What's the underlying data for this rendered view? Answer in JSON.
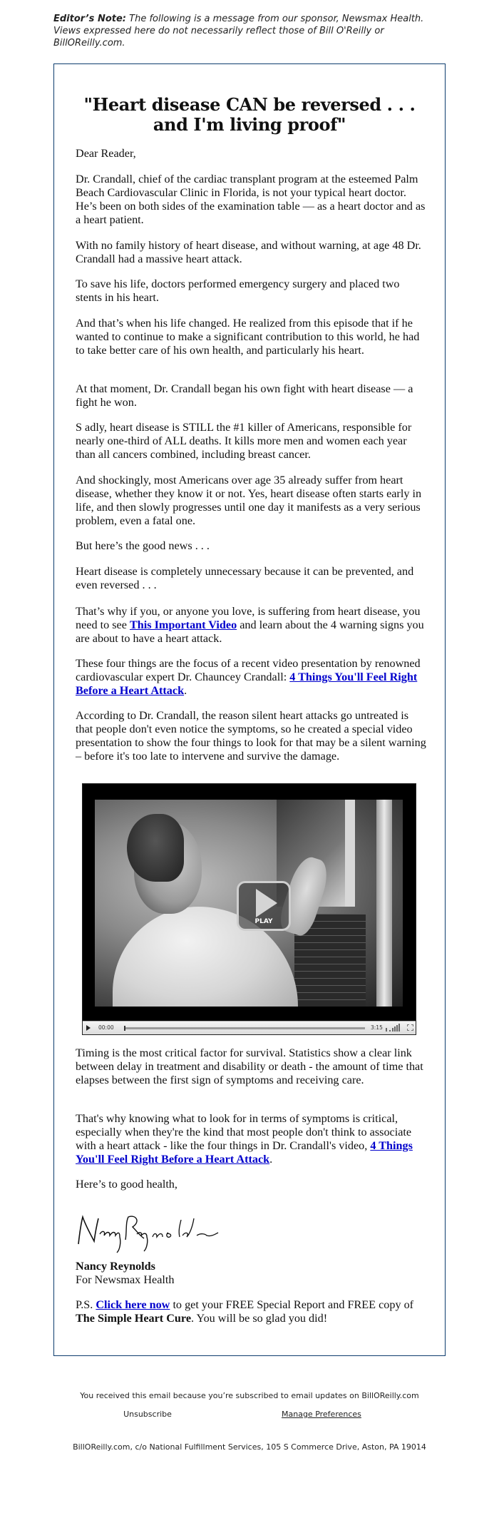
{
  "editor_note": {
    "label": "Editor’s Note:",
    "text": " The following is a message from our sponsor, Newsmax Health. Views expressed here do not necessarily reflect those of Bill O'Reilly or BillOReilly.com."
  },
  "headline": {
    "line1": "\"Heart disease CAN be reversed . . .",
    "line2": "and I'm living proof\""
  },
  "body": {
    "salutation": "Dear Reader,",
    "p1": "Dr. Crandall, chief of the cardiac transplant program at the esteemed Palm Beach Cardiovascular Clinic in Florida, is not your typical heart doctor. He’s been on both sides of the examination table — as a heart doctor and as a heart patient.",
    "p2": "With no family history of heart disease, and without warning, at age 48 Dr. Crandall had a massive heart attack.",
    "p3": "To save his life, doctors performed emergency surgery and placed two stents in his heart.",
    "p4": "And that’s when his life changed. He realized from this episode that if he wanted to continue to make a significant contribution to this world, he had to take better care of his own health, and particularly his heart.",
    "p5": "At that moment, Dr. Crandall began his own fight with heart disease — a fight he won.",
    "p6": "S adly, heart disease is STILL the #1 killer of Americans, responsible for nearly one-third of ALL deaths. It kills more men and women each year than all cancers combined, including breast cancer.",
    "p7": "And shockingly, most Americans over age 35 already suffer from heart disease, whether they know it or not. Yes, heart disease often starts early in life, and then slowly progresses until one day it manifests as a very serious problem, even a fatal one.",
    "p8": "But here’s the good news . . .",
    "p9": "Heart disease is completely unnecessary because it can be prevented, and even reversed . . .",
    "p10_pre": "That’s why if you, or anyone you love, is suffering from heart disease, you need to see ",
    "p10_link": "This Important Video",
    "p10_post": " and learn about the 4 warning signs you are about to have a heart attack.",
    "p11_pre": "These four things are the focus of a recent video presentation by renowned cardiovascular expert Dr. Chauncey Crandall: ",
    "p11_link": "4 Things You'll Feel Right Before a Heart Attack",
    "p11_post": ".",
    "p12": "According to Dr. Crandall, the reason silent heart attacks go untreated is that people don't even notice the symptoms, so he created a special video presentation to show the four things to look for that may be a silent warning – before it's too late to intervene and survive the damage.",
    "p13": "Timing is the most critical factor for survival. Statistics show a clear link between delay in treatment and disability or death - the amount of time that elapses between the first sign of symptoms and receiving care.",
    "p14_pre": "That's why knowing what to look for in terms of symptoms is critical, especially when they're the kind that most people don't think to associate with a heart attack - like the four things in Dr. Crandall's video, ",
    "p14_link": "4 Things You'll Feel Right Before a Heart Attack",
    "p14_post": ".",
    "closing": "Here’s to good health,",
    "signer_name": "Nancy Reynolds",
    "signer_org": "For Newsmax Health",
    "ps_pre": "P.S. ",
    "ps_link": "Click here now",
    "ps_mid": " to get your FREE Special Report and FREE copy of ",
    "ps_bold": "The Simple Heart Cure",
    "ps_post": ". You will be so glad you did!"
  },
  "video": {
    "play_label": "PLAY",
    "current_time": "00:00",
    "duration": "3:15",
    "progress": 0
  },
  "footer": {
    "subscription_note": "You received this email because you’re subscribed to email updates on BillOReilly.com",
    "unsubscribe": "Unsubscribe",
    "manage_preferences": "Manage Preferences",
    "address": "BillOReilly.com, c/o National Fulfillment Services, 105 S Commerce Drive, Aston, PA 19014"
  },
  "colors": {
    "frame_border": "#0d3c6e",
    "link": "#0000cc"
  }
}
